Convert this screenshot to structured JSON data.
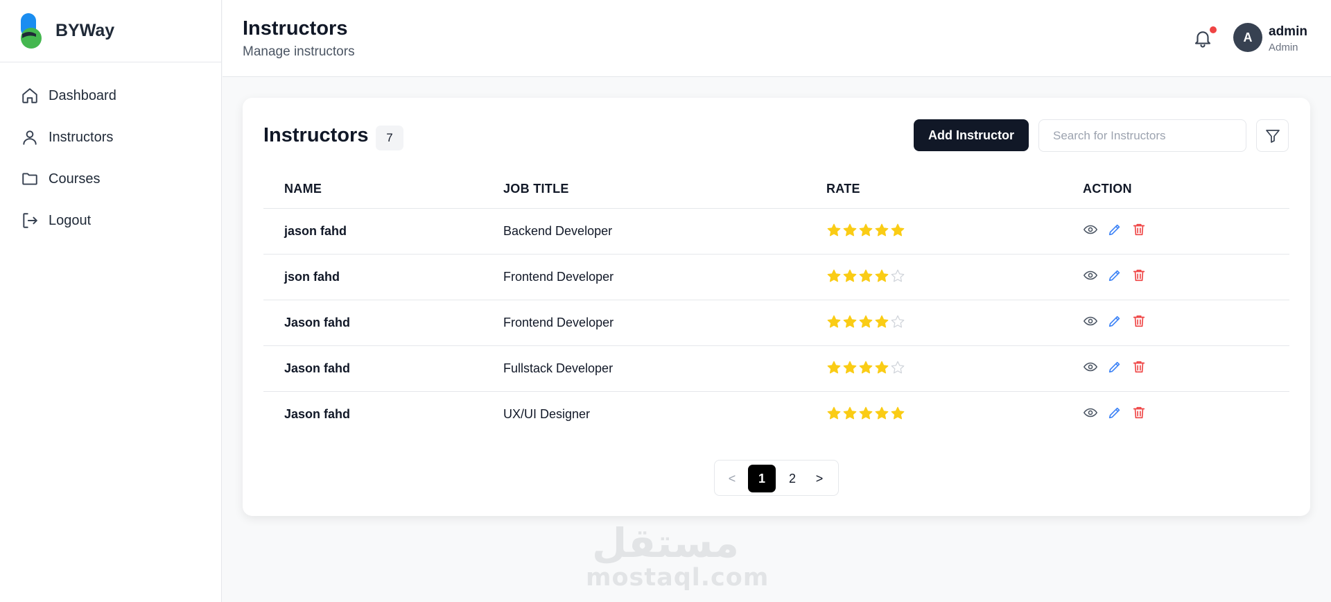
{
  "brand": {
    "name": "BYWay",
    "colors": {
      "blue": "#1a8df0",
      "green": "#44b74f",
      "dark": "#1f2937"
    }
  },
  "sidebar": {
    "items": [
      {
        "label": "Dashboard",
        "icon": "home-icon"
      },
      {
        "label": "Instructors",
        "icon": "user-icon"
      },
      {
        "label": "Courses",
        "icon": "folder-icon"
      },
      {
        "label": "Logout",
        "icon": "logout-icon"
      }
    ]
  },
  "header": {
    "title": "Instructors",
    "subtitle": "Manage instructors",
    "notifications_icon": "bell-icon",
    "user": {
      "initial": "A",
      "name": "admin",
      "role": "Admin"
    }
  },
  "card": {
    "title": "Instructors",
    "count": "7",
    "add_button": "Add Instructor",
    "search_placeholder": "Search for Instructors",
    "filter_icon": "filter-icon"
  },
  "table": {
    "columns": [
      "NAME",
      "JOB TITLE",
      "RATE",
      "ACTION"
    ],
    "rows": [
      {
        "name": "jason fahd",
        "job": "Backend Developer",
        "rating": 5
      },
      {
        "name": "json fahd",
        "job": "Frontend Developer",
        "rating": 4
      },
      {
        "name": "Jason fahd",
        "job": "Frontend Developer",
        "rating": 4
      },
      {
        "name": "Jason fahd",
        "job": "Fullstack Developer",
        "rating": 4
      },
      {
        "name": "Jason fahd",
        "job": "UX/UI Designer",
        "rating": 5
      }
    ],
    "max_rating": 5,
    "action_icons": [
      "eye-icon",
      "pencil-icon",
      "trash-icon"
    ]
  },
  "pagination": {
    "prev": "<",
    "pages": [
      "1",
      "2"
    ],
    "current": "1",
    "next": ">"
  },
  "colors": {
    "star": "#facc15",
    "star_empty": "#d1d5db",
    "edit": "#3b82f6",
    "delete": "#ef4444",
    "view": "#4b5563",
    "dark_button": "#111827"
  },
  "watermark": {
    "arabic": "مستقل",
    "latin": "mostaql.com"
  }
}
